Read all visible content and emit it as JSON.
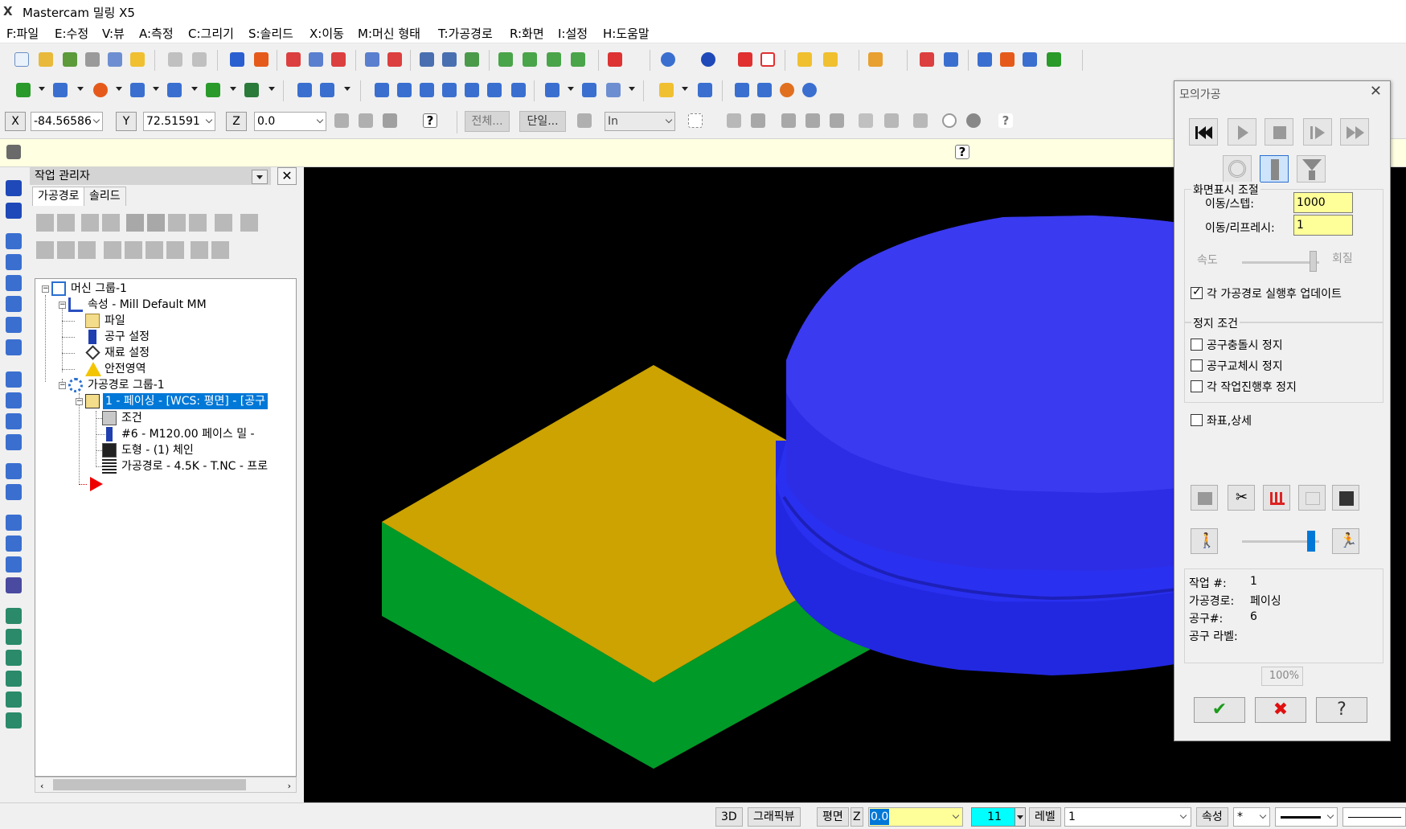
{
  "window": {
    "title": "Mastercam 밀링 X5",
    "logo_glyph": "X"
  },
  "menu": [
    "F:파일",
    "E:수정",
    "V:뷰",
    "A:측정",
    "C:그리기",
    "S:솔리드",
    "X:이동",
    "M:머신 형태",
    "T:가공경로",
    "R:화면",
    "I:설정",
    "H:도움말"
  ],
  "coords": {
    "x_label": "X",
    "x_value": "-84.56586",
    "y_label": "Y",
    "y_value": "72.51591",
    "z_label": "Z",
    "z_value": "0.0",
    "all_button": "전체...",
    "single_button": "단일...",
    "unit_value": "In"
  },
  "op_manager": {
    "title": "작업 관리자",
    "tabs": [
      "가공경로",
      "솔리드"
    ],
    "tree": [
      {
        "label": "머신 그룹-1",
        "icon": "machine-group-icon"
      },
      {
        "label": "속성 - Mill Default MM",
        "icon": "properties-icon"
      },
      {
        "label": "파일",
        "icon": "folder-icon"
      },
      {
        "label": "공구 설정",
        "icon": "tool-settings-icon"
      },
      {
        "label": "재료 설정",
        "icon": "stock-setup-icon"
      },
      {
        "label": "안전영역",
        "icon": "warning-icon"
      },
      {
        "label": "가공경로 그룹-1",
        "icon": "toolpath-group-icon"
      },
      {
        "label": "1 - 페이싱 - [WCS: 평면] - [공구",
        "icon": "open-folder-icon"
      },
      {
        "label": "조건",
        "icon": "parameters-icon"
      },
      {
        "label": "#6 - M120.00 페이스 밀 -",
        "icon": "tool-icon"
      },
      {
        "label": "도형 - (1) 체인",
        "icon": "geometry-icon"
      },
      {
        "label": "가공경로 - 4.5K - T.NC - 프로",
        "icon": "toolpath-icon"
      }
    ]
  },
  "status": {
    "mode_3d": "3D",
    "gview": "그래픽뷰",
    "plane": "평면",
    "z_label": "Z",
    "z_value": "0.0",
    "color_value": "11",
    "level_label": "레벨",
    "level_value": "1",
    "attr_label": "속성",
    "style_value": "*"
  },
  "simulation": {
    "title": "모의가공",
    "display_group": "화면표시 조절",
    "move_step_label": "이동/스텝:",
    "move_step_value": "1000",
    "move_refresh_label": "이동/리프레시:",
    "move_refresh_value": "1",
    "speed_label": "속도",
    "quality_label": "회질",
    "update_each_label": "각 가공경로 실행후 업데이트",
    "update_each_checked": true,
    "stop_group": "정지 조건",
    "stop_collision_label": "공구충돌시 정지",
    "stop_toolchange_label": "공구교체시 정지",
    "stop_each_label": "각 작업진행후 정지",
    "coord_detail_label": "좌표,상세",
    "op_no_label": "작업 #:",
    "op_no_value": "1",
    "toolpath_label": "가공경로:",
    "toolpath_value": "페이싱",
    "tool_no_label": "공구#:",
    "tool_no_value": "6",
    "tool_label_label": "공구 라벨:",
    "tool_label_value": "",
    "percent_value": "100%",
    "speed_slider": 0.92,
    "run_slider": 0.9
  },
  "colors": {
    "stock_top": "#cca300",
    "stock_side": "#009a28",
    "tool_body": "#2a2ae8",
    "selection": "#0078d7",
    "accent_yellow": "#ffff99"
  }
}
